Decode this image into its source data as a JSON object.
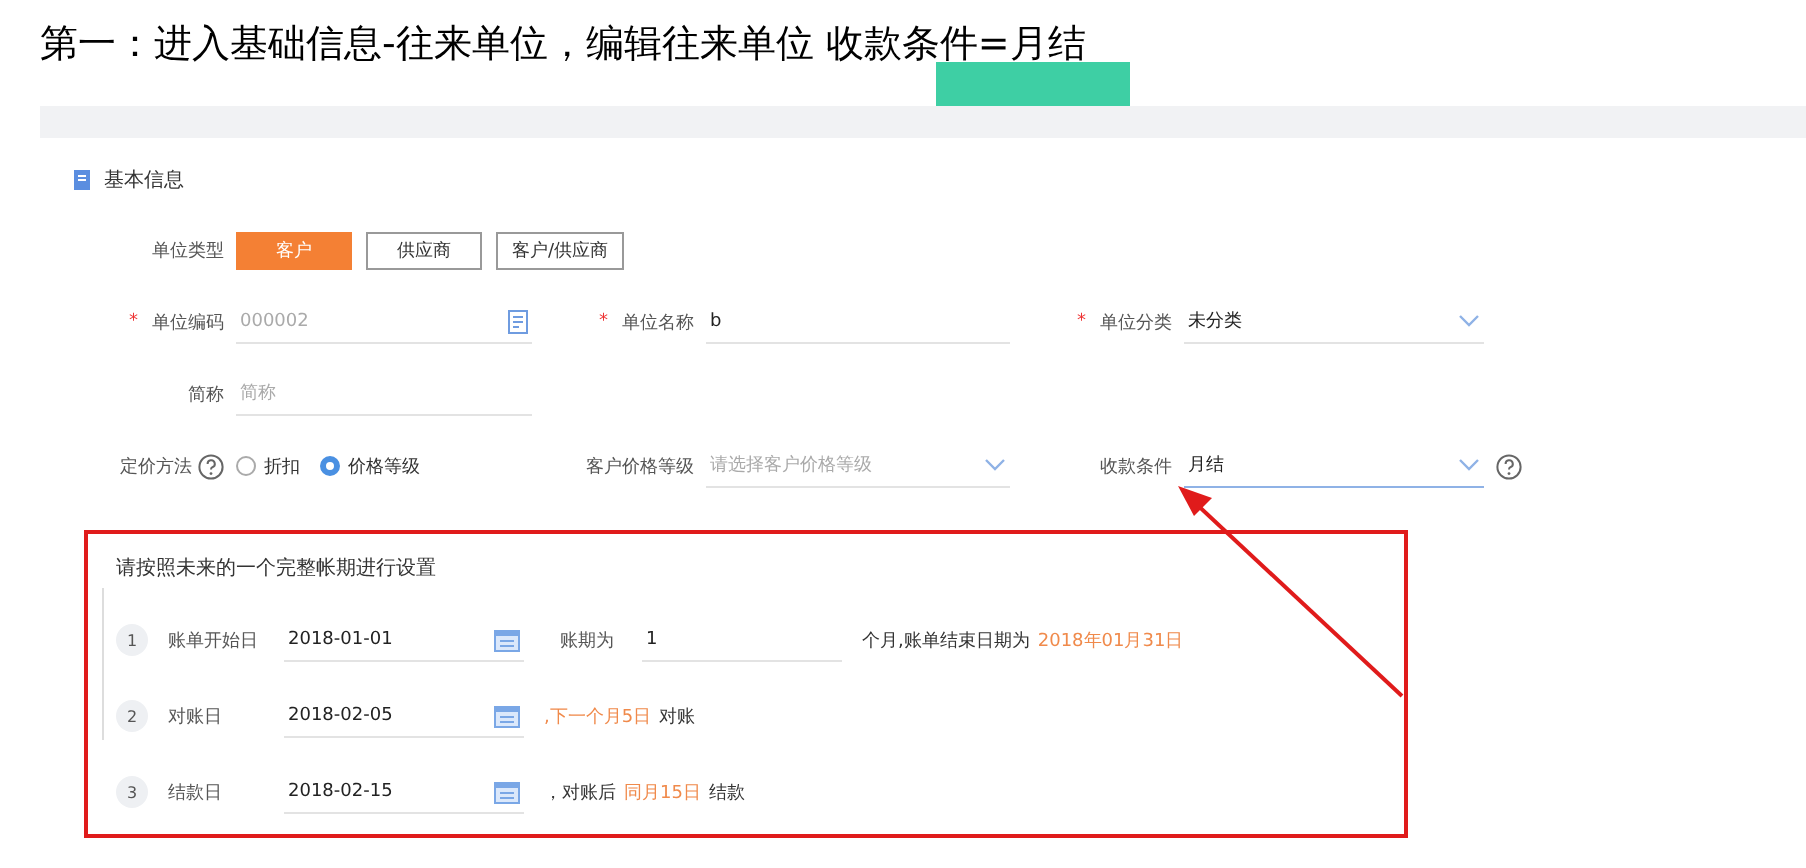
{
  "heading": "第一：进入基础信息-往来单位，编辑往来单位 收款条件=月结",
  "section_title": "基本信息",
  "unit_type": {
    "label": "单位类型",
    "options": [
      {
        "label": "客户",
        "selected": true
      },
      {
        "label": "供应商",
        "selected": false
      },
      {
        "label": "客户/供应商",
        "selected": false
      }
    ]
  },
  "rows": [
    [
      {
        "kind": "code",
        "label": "单位编码",
        "required_mark": "*",
        "value": "000002",
        "disabled": true
      },
      {
        "kind": "text",
        "label": "单位名称",
        "required_mark": "*",
        "value": "b"
      },
      {
        "kind": "select",
        "label": "单位分类",
        "required_mark": "*",
        "value": "未分类"
      }
    ],
    [
      {
        "kind": "text",
        "label": "简称",
        "placeholder": "简称"
      }
    ],
    [
      {
        "kind": "radio",
        "label": "定价方法",
        "help": true,
        "options": [
          {
            "label": "折扣",
            "selected": false
          },
          {
            "label": "价格等级",
            "selected": true
          }
        ]
      },
      {
        "kind": "select",
        "label": "客户价格等级",
        "placeholder": "请选择客户价格等级"
      },
      {
        "kind": "select",
        "label": "收款条件",
        "value": "月结",
        "help": true,
        "focused": true
      }
    ]
  ],
  "billing": {
    "title": "请按照未来的一个完整帐期进行设置",
    "steps": [
      {
        "number": "1",
        "label": "账单开始日",
        "date": "2018-01-01",
        "parts": [
          {
            "kind": "label",
            "text": "账期为"
          },
          {
            "kind": "input",
            "text": "1"
          },
          {
            "kind": "text",
            "text": "个月,账单结束日期为"
          },
          {
            "kind": "highlight",
            "text": "2018年01月31日"
          }
        ]
      },
      {
        "number": "2",
        "label": "对账日",
        "date": "2018-02-05",
        "parts": [
          {
            "kind": "highlight",
            "text": ",下一个月5日"
          },
          {
            "kind": "text",
            "text": "对账"
          }
        ]
      },
      {
        "number": "3",
        "label": "结款日",
        "date": "2018-02-15",
        "parts": [
          {
            "kind": "text",
            "text": "，对账后"
          },
          {
            "kind": "highlight",
            "text": "同月15日"
          },
          {
            "kind": "text",
            "text": "结款"
          }
        ]
      }
    ]
  }
}
